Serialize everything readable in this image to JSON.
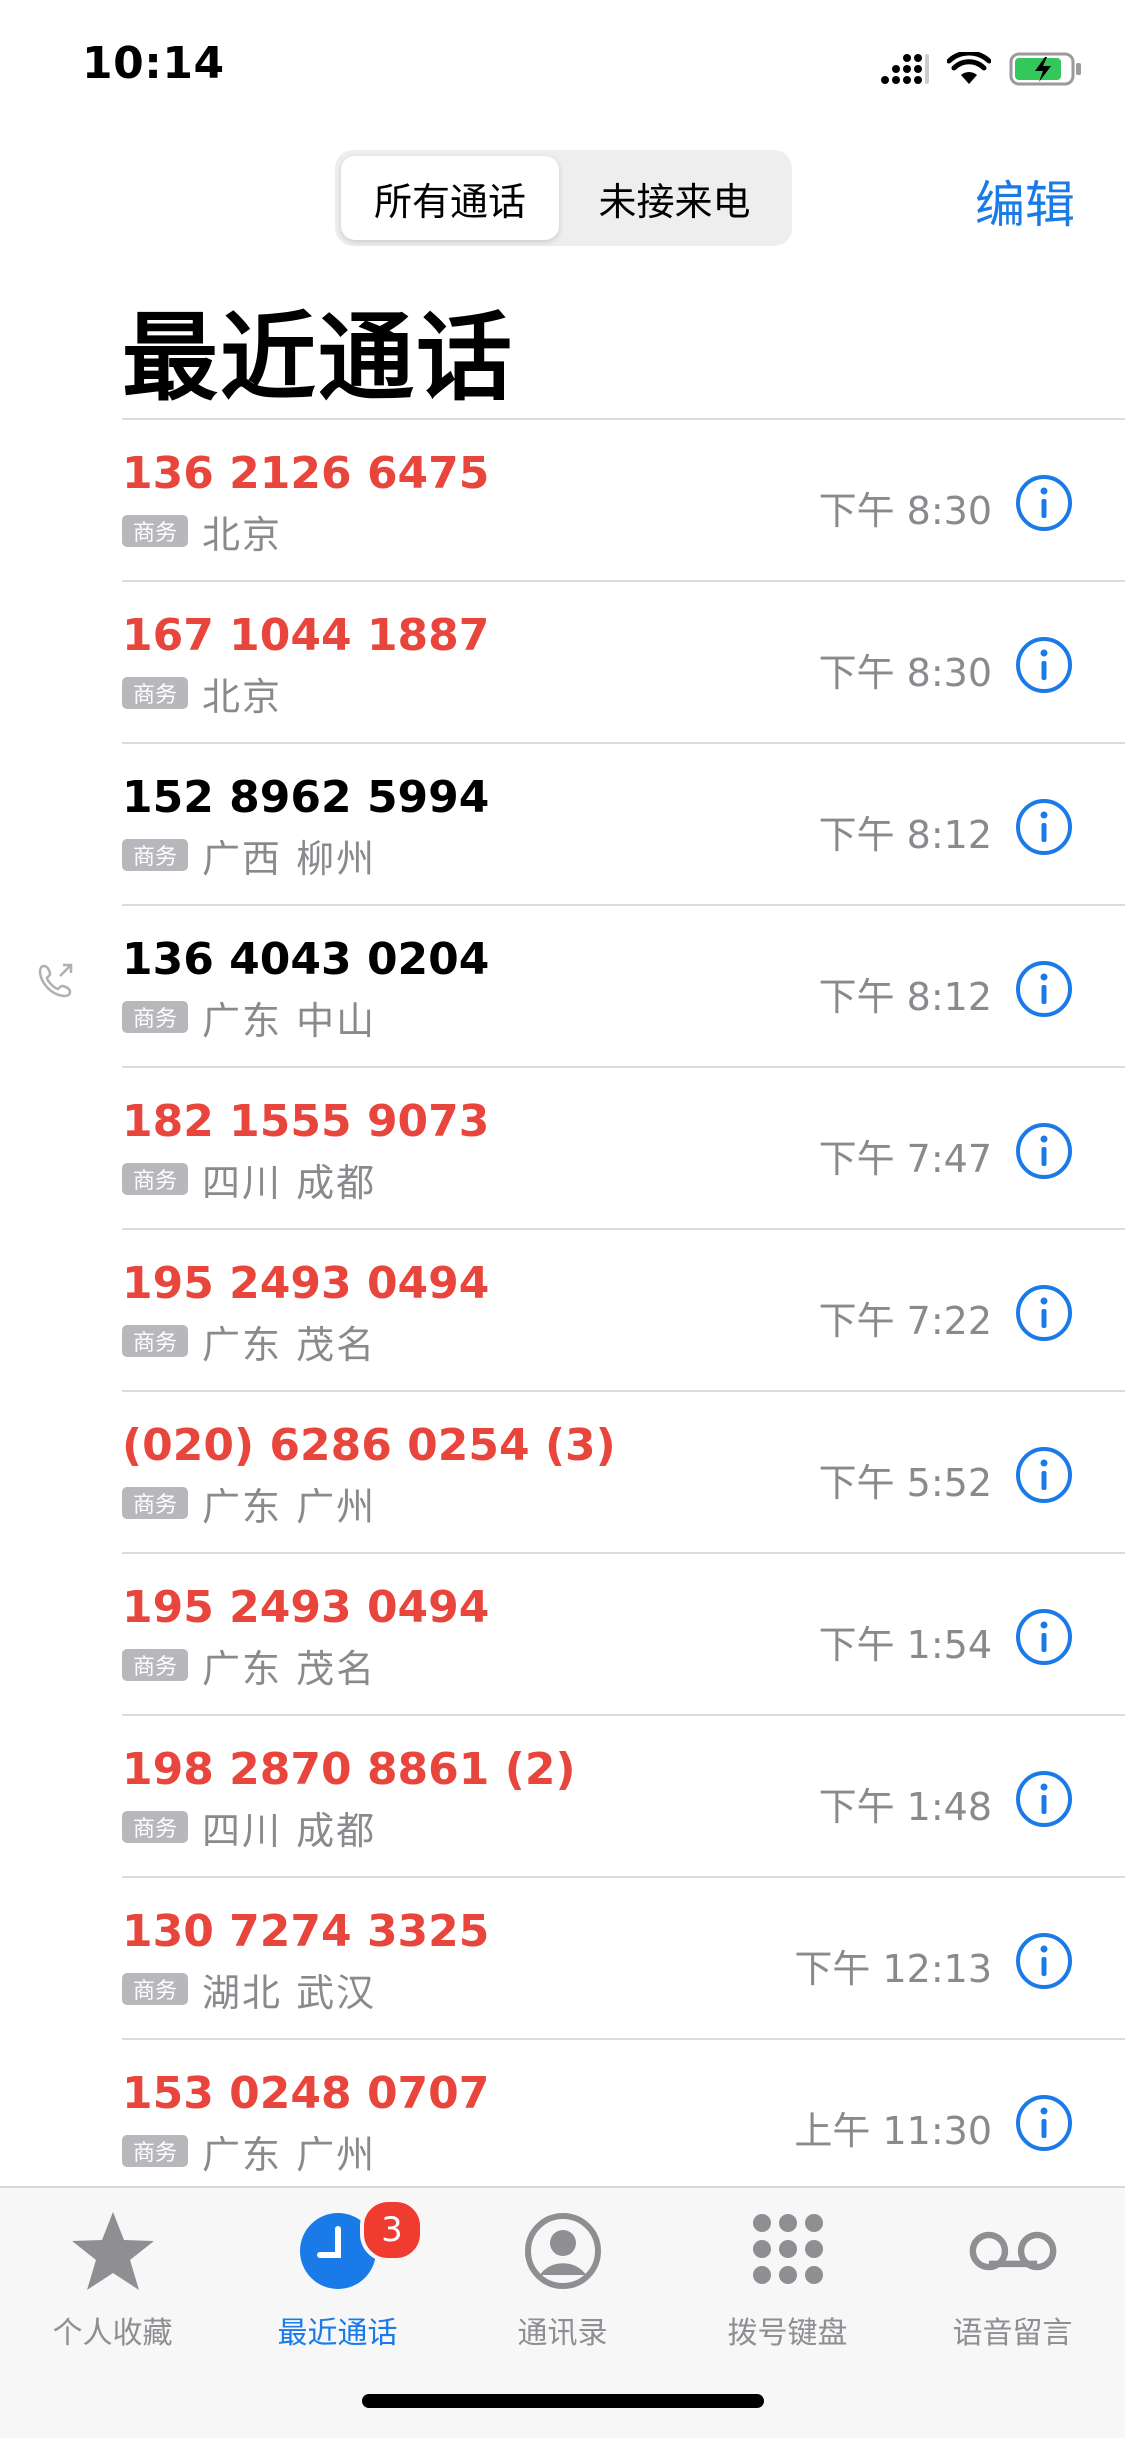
{
  "status": {
    "time": "10:14"
  },
  "header": {
    "segments": [
      "所有通话",
      "未接来电"
    ],
    "edit_label": "编辑",
    "title": "最近通话"
  },
  "colors": {
    "accent": "#1a7be8",
    "missed": "#e8453c",
    "badge": "#ef3b30"
  },
  "calls": [
    {
      "number": "136 2126 6475",
      "missed": true,
      "tag": "商务",
      "location": "北京",
      "time": "下午 8:30"
    },
    {
      "number": "167 1044 1887",
      "missed": true,
      "tag": "商务",
      "location": "北京",
      "time": "下午 8:30"
    },
    {
      "number": "152 8962 5994",
      "missed": false,
      "tag": "商务",
      "location": "广西 柳州",
      "time": "下午 8:12"
    },
    {
      "number": "136 4043 0204",
      "missed": false,
      "outgoing": true,
      "tag": "商务",
      "location": "广东 中山",
      "time": "下午 8:12"
    },
    {
      "number": "182 1555 9073",
      "missed": true,
      "tag": "商务",
      "location": "四川 成都",
      "time": "下午 7:47"
    },
    {
      "number": "195 2493 0494",
      "missed": true,
      "tag": "商务",
      "location": "广东 茂名",
      "time": "下午 7:22"
    },
    {
      "number": "(020) 6286 0254 (3)",
      "missed": true,
      "tag": "商务",
      "location": "广东 广州",
      "time": "下午 5:52"
    },
    {
      "number": "195 2493 0494",
      "missed": true,
      "tag": "商务",
      "location": "广东 茂名",
      "time": "下午 1:54"
    },
    {
      "number": "198 2870 8861 (2)",
      "missed": true,
      "tag": "商务",
      "location": "四川 成都",
      "time": "下午 1:48"
    },
    {
      "number": "130 7274 3325",
      "missed": true,
      "tag": "商务",
      "location": "湖北 武汉",
      "time": "下午 12:13"
    },
    {
      "number": "153 0248 0707",
      "missed": true,
      "tag": "商务",
      "location": "广东 广州",
      "time": "上午 11:30"
    }
  ],
  "tabbar": {
    "tabs": [
      {
        "label": "个人收藏",
        "icon": "star-icon"
      },
      {
        "label": "最近通话",
        "icon": "clock-icon",
        "active": true,
        "badge": "3"
      },
      {
        "label": "通讯录",
        "icon": "contacts-icon"
      },
      {
        "label": "拨号键盘",
        "icon": "keypad-icon"
      },
      {
        "label": "语音留言",
        "icon": "voicemail-icon"
      }
    ]
  }
}
